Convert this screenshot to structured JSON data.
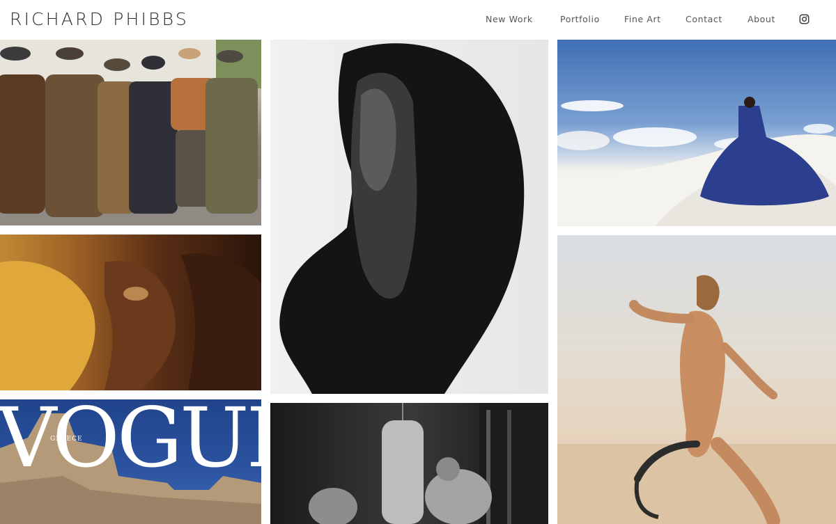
{
  "brand": {
    "name": "RICHARD PHIBBS"
  },
  "nav": {
    "items": [
      {
        "label": "New Work"
      },
      {
        "label": "Portfolio"
      },
      {
        "label": "Fine Art"
      },
      {
        "label": "Contact"
      },
      {
        "label": "About"
      }
    ],
    "social_icon": "instagram-icon"
  },
  "gallery": {
    "vogue_cover": {
      "masthead": "VOGUE",
      "edition": "GREECE"
    }
  }
}
